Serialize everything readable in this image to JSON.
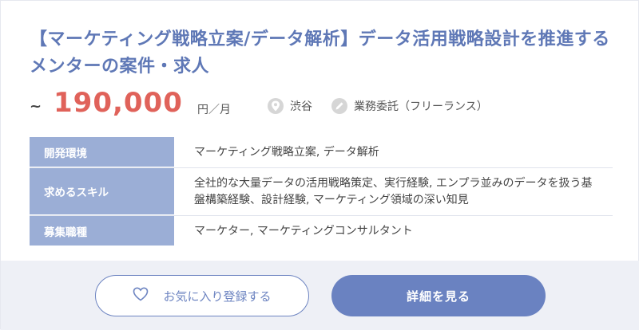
{
  "job": {
    "title": "【マーケティング戦略立案/データ解析】データ活用戦略設計を推進するメンターの案件・求人",
    "salary": {
      "prefix": "~",
      "amount": "190,000",
      "unit": "円／月"
    },
    "location": "渋谷",
    "employment_type": "業務委託（フリーランス）"
  },
  "details": [
    {
      "label": "開発環境",
      "value": "マーケティング戦略立案, データ解析"
    },
    {
      "label": "求めるスキル",
      "value": "全社的な大量データの活用戦略策定、実行経験, エンプラ並みのデータを扱う基盤構築経験、設計経験, マーケティング領域の深い知見"
    },
    {
      "label": "募集職種",
      "value": "マーケター, マーケティングコンサルタント"
    }
  ],
  "actions": {
    "favorite_label": "お気に入り登録する",
    "detail_label": "詳細を見る"
  },
  "icons": {
    "location": "map-pin-icon",
    "employment": "pencil-icon",
    "favorite": "heart-icon"
  },
  "colors": {
    "title": "#5f78b6",
    "price": "#e0625a",
    "table_header": "#9baed6",
    "primary_button": "#6a82c1"
  }
}
